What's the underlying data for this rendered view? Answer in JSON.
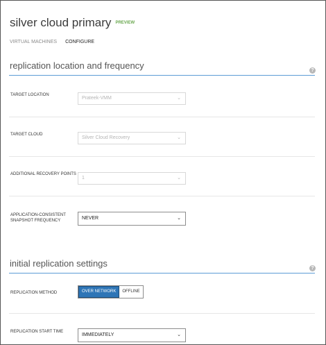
{
  "header": {
    "title": "silver cloud primary",
    "badge": "PREVIEW"
  },
  "tabs": [
    {
      "label": "VIRTUAL MACHINES",
      "active": false
    },
    {
      "label": "CONFIGURE",
      "active": true
    }
  ],
  "sections": {
    "replication": {
      "title": "replication location and frequency",
      "help_icon": "question-icon"
    },
    "initial": {
      "title": "initial replication settings",
      "help_icon": "question-icon"
    }
  },
  "fields": {
    "target_location": {
      "label": "TARGET LOCATION",
      "value": "Prateek-VMM",
      "enabled": false
    },
    "target_cloud": {
      "label": "TARGET CLOUD",
      "value": "Silver Cloud Recovery",
      "enabled": false
    },
    "recovery_points": {
      "label": "ADDITIONAL RECOVERY POINTS",
      "value": "1",
      "enabled": false
    },
    "snapshot_frequency": {
      "label": "APPLICATION-CONSISTENT SNAPSHOT FREQUENCY",
      "value": "NEVER",
      "enabled": true
    },
    "replication_method": {
      "label": "REPLICATION METHOD",
      "options": [
        "OVER NETWORK",
        "OFFLINE"
      ],
      "selected": "OVER NETWORK"
    },
    "start_time": {
      "label": "REPLICATION START TIME",
      "value": "IMMEDIATELY",
      "enabled": true
    }
  },
  "colors": {
    "accent": "#2e75b6",
    "section_rule": "#5b9bd5",
    "badge": "#6aa84f"
  },
  "icons": {
    "chevron": "chevron-down-icon",
    "help": "question-icon"
  }
}
